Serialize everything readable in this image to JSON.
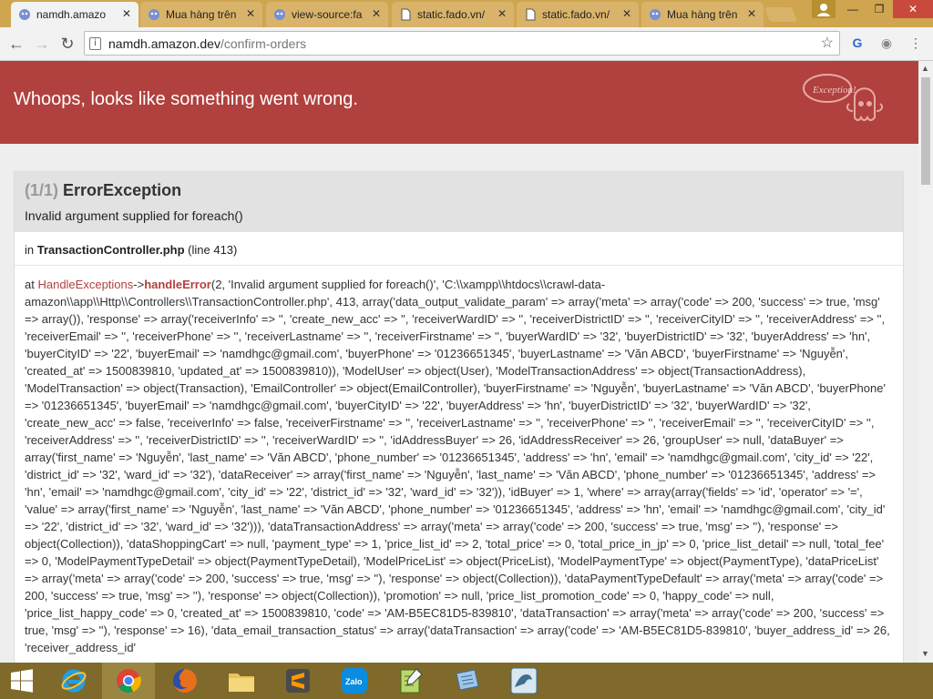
{
  "browser": {
    "tabs": [
      {
        "title": "namdh.amazo",
        "active": true,
        "favicon": "amazon-ghost-icon"
      },
      {
        "title": "Mua hàng trên",
        "active": false,
        "favicon": "amazon-ghost-icon"
      },
      {
        "title": "view-source:fa",
        "active": false,
        "favicon": "amazon-ghost-icon"
      },
      {
        "title": "static.fado.vn/",
        "active": false,
        "favicon": "document-icon"
      },
      {
        "title": "static.fado.vn/",
        "active": false,
        "favicon": "document-icon"
      },
      {
        "title": "Mua hàng trên",
        "active": false,
        "favicon": "amazon-ghost-icon"
      }
    ],
    "url": {
      "host": "namdh.amazon.dev",
      "path": "/confirm-orders"
    }
  },
  "page": {
    "header_title": "Whoops, looks like something went wrong.",
    "ghost_badge": "Exception!",
    "exception": {
      "count": "(1/1)",
      "name": "ErrorException",
      "message": "Invalid argument supplied for foreach()",
      "location_prefix": "in",
      "file": "TransactionController.php",
      "line": "(line 413)"
    },
    "trace": {
      "at": "at",
      "class": "HandleExceptions",
      "arrow": "->",
      "function": "handleError",
      "args": "(2, 'Invalid argument supplied for foreach()', 'C:\\\\xampp\\\\htdocs\\\\crawl-data-amazon\\\\app\\\\Http\\\\Controllers\\\\TransactionController.php', 413, array('data_output_validate_param' => array('meta' => array('code' => 200, 'success' => true, 'msg' => array()), 'response' => array('receiverInfo' => '', 'create_new_acc' => '', 'receiverWardID' => '', 'receiverDistrictID' => '', 'receiverCityID' => '', 'receiverAddress' => '', 'receiverEmail' => '', 'receiverPhone' => '', 'receiverLastname' => '', 'receiverFirstname' => '', 'buyerWardID' => '32', 'buyerDistrictID' => '32', 'buyerAddress' => 'hn', 'buyerCityID' => '22', 'buyerEmail' => 'namdhgc@gmail.com', 'buyerPhone' => '01236651345', 'buyerLastname' => 'Văn ABCD', 'buyerFirstname' => 'Nguyễn', 'created_at' => 1500839810, 'updated_at' => 1500839810)), 'ModelUser' => object(User), 'ModelTransactionAddress' => object(TransactionAddress), 'ModelTransaction' => object(Transaction), 'EmailController' => object(EmailController), 'buyerFirstname' => 'Nguyễn', 'buyerLastname' => 'Văn ABCD', 'buyerPhone' => '01236651345', 'buyerEmail' => 'namdhgc@gmail.com', 'buyerCityID' => '22', 'buyerAddress' => 'hn', 'buyerDistrictID' => '32', 'buyerWardID' => '32', 'create_new_acc' => false, 'receiverInfo' => false, 'receiverFirstname' => '', 'receiverLastname' => '', 'receiverPhone' => '', 'receiverEmail' => '', 'receiverCityID' => '', 'receiverAddress' => '', 'receiverDistrictID' => '', 'receiverWardID' => '', 'idAddressBuyer' => 26, 'idAddressReceiver' => 26, 'groupUser' => null, 'dataBuyer' => array('first_name' => 'Nguyễn', 'last_name' => 'Văn ABCD', 'phone_number' => '01236651345', 'address' => 'hn', 'email' => 'namdhgc@gmail.com', 'city_id' => '22', 'district_id' => '32', 'ward_id' => '32'), 'dataReceiver' => array('first_name' => 'Nguyễn', 'last_name' => 'Văn ABCD', 'phone_number' => '01236651345', 'address' => 'hn', 'email' => 'namdhgc@gmail.com', 'city_id' => '22', 'district_id' => '32', 'ward_id' => '32')), 'idBuyer' => 1, 'where' => array(array('fields' => 'id', 'operator' => '=', 'value' => array('first_name' => 'Nguyễn', 'last_name' => 'Văn ABCD', 'phone_number' => '01236651345', 'address' => 'hn', 'email' => 'namdhgc@gmail.com', 'city_id' => '22', 'district_id' => '32', 'ward_id' => '32'))), 'dataTransactionAddress' => array('meta' => array('code' => 200, 'success' => true, 'msg' => ''), 'response' => object(Collection)), 'dataShoppingCart' => null, 'payment_type' => 1, 'price_list_id' => 2, 'total_price' => 0, 'total_price_in_jp' => 0, 'price_list_detail' => null, 'total_fee' => 0, 'ModelPaymentTypeDetail' => object(PaymentTypeDetail), 'ModelPriceList' => object(PriceList), 'ModelPaymentType' => object(PaymentType), 'dataPriceList' => array('meta' => array('code' => 200, 'success' => true, 'msg' => ''), 'response' => object(Collection)), 'dataPaymentTypeDefault' => array('meta' => array('code' => 200, 'success' => true, 'msg' => ''), 'response' => object(Collection)), 'promotion' => null, 'price_list_promotion_code' => 0, 'happy_code' => null, 'price_list_happy_code' => 0, 'created_at' => 1500839810, 'code' => 'AM-B5EC81D5-839810', 'dataTransaction' => array('meta' => array('code' => 200, 'success' => true, 'msg' => ''), 'response' => 16), 'data_email_transaction_status' => array('dataTransaction' => array('code' => 'AM-B5EC81D5-839810', 'buyer_address_id' => 26, 'receiver_address_id'"
    }
  },
  "taskbar": {
    "items": [
      "windows-start-icon",
      "internet-explorer-icon",
      "chrome-icon",
      "firefox-icon",
      "file-explorer-icon",
      "sublime-text-icon",
      "zalo-icon",
      "notepad-plus-plus-icon",
      "notepad-icon",
      "mysql-workbench-icon"
    ],
    "zalo_label": "Zalo"
  },
  "colors": {
    "header": "#b0413e",
    "tabstrip": "#cfa54f",
    "taskbar": "#7f6a2c"
  }
}
